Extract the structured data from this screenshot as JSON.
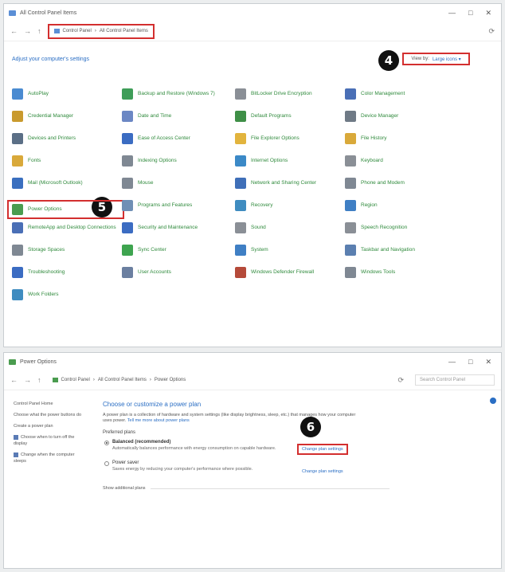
{
  "window1": {
    "title": "All Control Panel Items",
    "controls": [
      "—",
      "□",
      "✕"
    ],
    "breadcrumb": [
      "Control Panel",
      "All Control Panel Items"
    ],
    "heading": "Adjust your computer's settings",
    "view_by": {
      "label": "View by:",
      "value": "Large icons ▾"
    },
    "step_markers": {
      "four": "4",
      "five": "5"
    },
    "items": [
      {
        "label": "AutoPlay",
        "color": "#4a8bd1"
      },
      {
        "label": "Backup and Restore (Windows 7)",
        "color": "#3e9d58"
      },
      {
        "label": "BitLocker Drive Encryption",
        "color": "#8a8f96"
      },
      {
        "label": "Color Management",
        "color": "#4a6fb6"
      },
      {
        "label": "Credential Manager",
        "color": "#c99a2e"
      },
      {
        "label": "Date and Time",
        "color": "#6b87c4"
      },
      {
        "label": "Default Programs",
        "color": "#3f8f47"
      },
      {
        "label": "Device Manager",
        "color": "#6f7a86"
      },
      {
        "label": "Devices and Printers",
        "color": "#5b6f86"
      },
      {
        "label": "Ease of Access Center",
        "color": "#3b6cc2"
      },
      {
        "label": "File Explorer Options",
        "color": "#e2b43d"
      },
      {
        "label": "File History",
        "color": "#d9a93a"
      },
      {
        "label": "Fonts",
        "color": "#d9a93a"
      },
      {
        "label": "Indexing Options",
        "color": "#7f8893"
      },
      {
        "label": "Internet Options",
        "color": "#3b89c7"
      },
      {
        "label": "Keyboard",
        "color": "#8a8f96"
      },
      {
        "label": "Mail (Microsoft Outlook)",
        "color": "#3a6fbf"
      },
      {
        "label": "Mouse",
        "color": "#7f8893"
      },
      {
        "label": "Network and Sharing Center",
        "color": "#3f6fb8"
      },
      {
        "label": "Phone and Modem",
        "color": "#7f8893"
      },
      {
        "label": "Power Options",
        "color": "#4a9c4f"
      },
      {
        "label": "Programs and Features",
        "color": "#6f8fb5"
      },
      {
        "label": "Recovery",
        "color": "#3f8cc0"
      },
      {
        "label": "Region",
        "color": "#3f7fc4"
      },
      {
        "label": "RemoteApp and Desktop Connections",
        "color": "#4a6fb6"
      },
      {
        "label": "Security and Maintenance",
        "color": "#3b6cc2"
      },
      {
        "label": "Sound",
        "color": "#8a8f96"
      },
      {
        "label": "Speech Recognition",
        "color": "#8a8f96"
      },
      {
        "label": "Storage Spaces",
        "color": "#7f8893"
      },
      {
        "label": "Sync Center",
        "color": "#3ea44f"
      },
      {
        "label": "System",
        "color": "#3f7fc4"
      },
      {
        "label": "Taskbar and Navigation",
        "color": "#5b7fb0"
      },
      {
        "label": "Troubleshooting",
        "color": "#3b6cc2"
      },
      {
        "label": "User Accounts",
        "color": "#6b7fa0"
      },
      {
        "label": "Windows Defender Firewall",
        "color": "#b54a3a"
      },
      {
        "label": "Windows Tools",
        "color": "#7f8893"
      },
      {
        "label": "Work Folders",
        "color": "#3f8cc0"
      }
    ]
  },
  "window2": {
    "title": "Power Options",
    "controls": [
      "—",
      "□",
      "✕"
    ],
    "breadcrumb": [
      "Control Panel",
      "All Control Panel Items",
      "Power Options"
    ],
    "search_placeholder": "Search Control Panel",
    "sidebar": [
      "Control Panel Home",
      "Choose what the power buttons do",
      "Create a power plan",
      "Choose when to turn off the display",
      "Change when the computer sleeps"
    ],
    "main": {
      "title": "Choose or customize a power plan",
      "desc": "A power plan is a collection of hardware and system settings (like display brightness, sleep, etc.) that manages how your computer uses power.",
      "desc_link": "Tell me more about power plans",
      "preferred_label": "Preferred plans",
      "plan1": {
        "name": "Balanced (recommended)",
        "desc": "Automatically balances performance with energy consumption on capable hardware."
      },
      "plan2": {
        "name": "Power saver",
        "desc": "Saves energy by reducing your computer's performance where possible."
      },
      "change_plan_1": "Change plan settings",
      "change_plan_2": "Change plan settings",
      "more_plans": "Show additional plans"
    },
    "step_marker": "6"
  }
}
